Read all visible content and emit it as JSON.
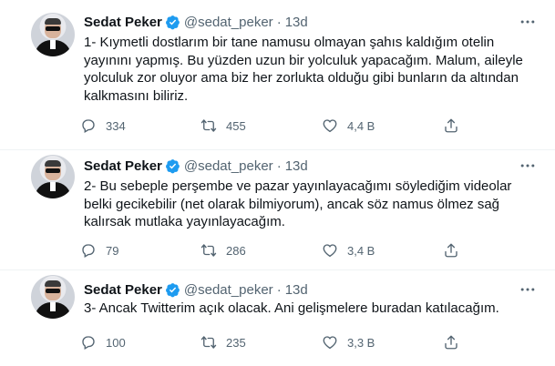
{
  "author": {
    "name": "Sedat Peker",
    "handle": "@sedat_peker",
    "separator": "·"
  },
  "colors": {
    "verified": "#1d9bf0",
    "text": "#0f1419",
    "muted": "#536471",
    "divider": "#eff3f4"
  },
  "icons": {
    "reply": "speech-bubble",
    "retweet": "retweet-arrows",
    "like": "heart",
    "share": "share-upload",
    "more": "ellipsis"
  },
  "tweets": [
    {
      "time": "13d",
      "text": "1- Kıymetli dostlarım bir tane namusu olmayan şahıs kaldığım otelin yayınını yapmış. Bu yüzden uzun bir yolculuk yapacağım. Malum, aileyle yolculuk zor oluyor ama biz her zorlukta olduğu gibi bunların da altından kalkmasını biliriz.",
      "replies": "334",
      "retweets": "455",
      "likes": "4,4 B"
    },
    {
      "time": "13d",
      "text": "2- Bu sebeple perşembe ve pazar yayınlayacağımı söylediğim videolar belki gecikebilir (net olarak bilmiyorum), ancak söz namus ölmez sağ kalırsak mutlaka yayınlayacağım.",
      "replies": "79",
      "retweets": "286",
      "likes": "3,4 B"
    },
    {
      "time": "13d",
      "text": "3- Ancak Twitterim açık olacak. Ani gelişmelere buradan katılacağım.",
      "replies": "100",
      "retweets": "235",
      "likes": "3,3 B"
    }
  ]
}
